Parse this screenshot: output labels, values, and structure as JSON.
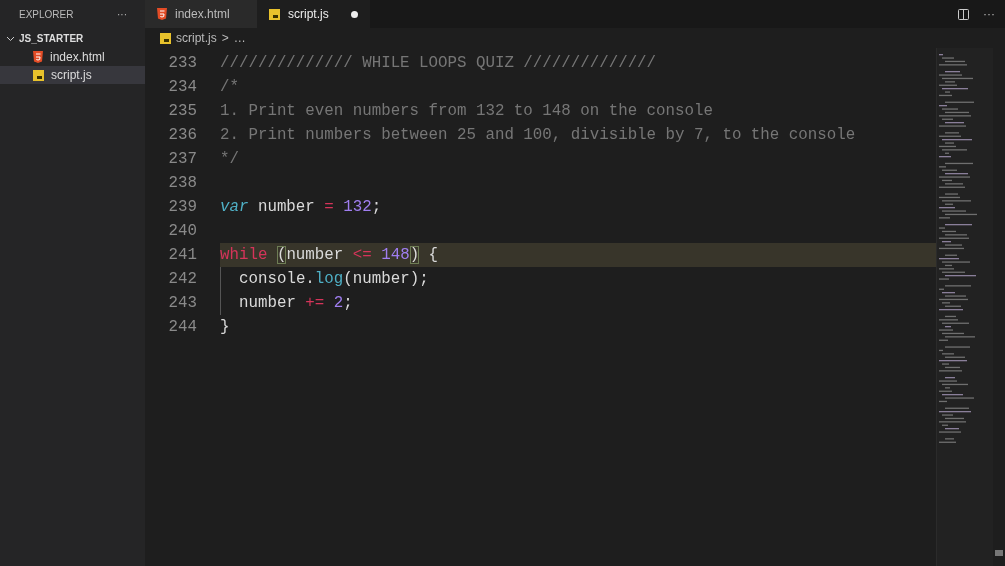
{
  "sidebar": {
    "title": "EXPLORER",
    "more": "···",
    "folder": {
      "name": "JS_STARTER",
      "expanded": true,
      "children": [
        {
          "name": "index.html",
          "kind": "html",
          "selected": false
        },
        {
          "name": "script.js",
          "kind": "js",
          "selected": true
        }
      ]
    }
  },
  "tabs": [
    {
      "label": "index.html",
      "kind": "html",
      "selected": false,
      "modified": false
    },
    {
      "label": "script.js",
      "kind": "js",
      "selected": true,
      "modified": true
    }
  ],
  "editor_actions": {
    "more": "···"
  },
  "breadcrumb": {
    "file": "script.js",
    "kind": "js",
    "separator": ">",
    "trail": "…"
  },
  "code": {
    "lines": [
      {
        "number": "233",
        "current": false,
        "indent": false,
        "tokens": [
          {
            "kind": "comment",
            "text": "////////////// WHILE LOOPS QUIZ //////////////"
          }
        ]
      },
      {
        "number": "234",
        "current": false,
        "indent": false,
        "tokens": [
          {
            "kind": "comment",
            "text": "/*"
          }
        ]
      },
      {
        "number": "235",
        "current": false,
        "indent": false,
        "tokens": [
          {
            "kind": "comment",
            "text": "1. Print even numbers from 132 to 148 on the console"
          }
        ]
      },
      {
        "number": "236",
        "current": false,
        "indent": false,
        "tokens": [
          {
            "kind": "comment",
            "text": "2. Print numbers between 25 and 100, divisible by 7, to the console"
          }
        ]
      },
      {
        "number": "237",
        "current": false,
        "indent": false,
        "tokens": [
          {
            "kind": "comment",
            "text": "*/"
          }
        ]
      },
      {
        "number": "238",
        "current": false,
        "indent": false
      },
      {
        "number": "239",
        "current": false,
        "indent": false,
        "tokens": [
          {
            "kind": "keyword",
            "text": "var"
          },
          {
            "kind": "plain",
            "text": " number"
          },
          {
            "kind": "operator",
            "text": " = "
          },
          {
            "kind": "number",
            "text": "132"
          },
          {
            "kind": "plain",
            "text": ";"
          }
        ]
      },
      {
        "number": "240",
        "current": false,
        "indent": false
      },
      {
        "number": "241",
        "current": true,
        "indent": false,
        "tokens": [
          {
            "kind": "control",
            "text": "while "
          },
          {
            "kind": "bracket",
            "text": "("
          },
          {
            "kind": "plain",
            "text": "number"
          },
          {
            "kind": "operator",
            "text": " <= "
          },
          {
            "kind": "number",
            "text": "148"
          },
          {
            "kind": "bracket",
            "text": ")"
          },
          {
            "kind": "plain",
            "text": " {"
          }
        ]
      },
      {
        "number": "242",
        "current": false,
        "indent": true,
        "tokens": [
          {
            "kind": "plain",
            "text": "console."
          },
          {
            "kind": "function",
            "text": "log"
          },
          {
            "kind": "plain",
            "text": "(number);"
          }
        ]
      },
      {
        "number": "243",
        "current": false,
        "indent": true,
        "tokens": [
          {
            "kind": "plain",
            "text": "number"
          },
          {
            "kind": "operator",
            "text": " += "
          },
          {
            "kind": "number",
            "text": "2"
          },
          {
            "kind": "plain",
            "text": ";"
          }
        ]
      },
      {
        "number": "244",
        "current": false,
        "indent": false,
        "tokens": [
          {
            "kind": "plain",
            "text": "}"
          }
        ]
      }
    ]
  }
}
